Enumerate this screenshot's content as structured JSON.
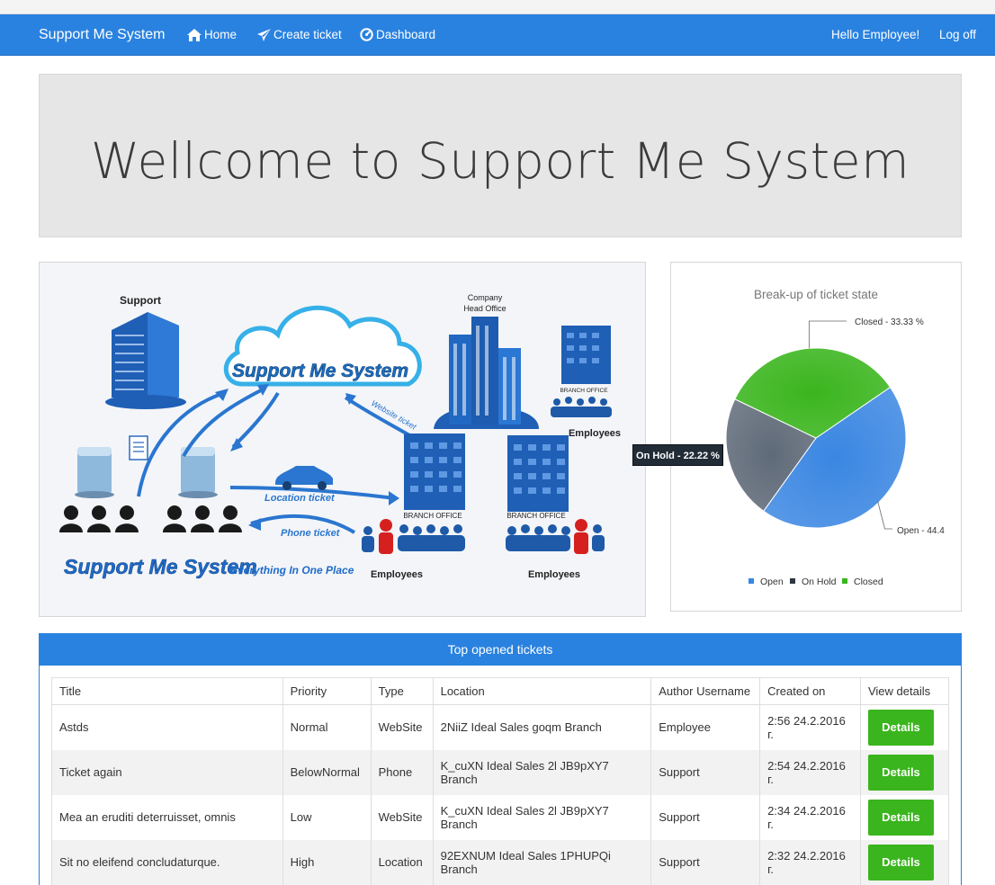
{
  "navbar": {
    "brand": "Support Me System",
    "links": [
      {
        "label": "Home",
        "icon": "home-icon"
      },
      {
        "label": "Create ticket",
        "icon": "paper-plane-icon"
      },
      {
        "label": "Dashboard",
        "icon": "dashboard-icon"
      }
    ],
    "greeting": "Hello Employee!",
    "logoff": "Log off",
    "color": "#2a82e0"
  },
  "jumbotron": {
    "heading": "Wellcome to Support Me System"
  },
  "illustration": {
    "labels": {
      "support": "Support",
      "head_office_1": "Company",
      "head_office_2": "Head Office",
      "cloud_text": "Support Me System",
      "website_ticket": "Website ticket",
      "location_ticket": "Location ticket",
      "phone_ticket": "Phone ticket",
      "branch_office": "BRANCH OFFICE",
      "employees": "Employees",
      "logo_main": "Support Me System",
      "logo_tagline": "Everything In One Place"
    }
  },
  "chart_data": {
    "type": "pie",
    "title": "Break-up of ticket state",
    "slices": [
      {
        "name": "Open",
        "value": 44.44,
        "label": "Open - 44.4",
        "color": "#3a86e2"
      },
      {
        "name": "On Hold",
        "value": 22.22,
        "label": "On Hold - 22.22 %",
        "color": "#5f6a78"
      },
      {
        "name": "Closed",
        "value": 33.33,
        "label": "Closed - 33.33 %",
        "color": "#3ab51d"
      }
    ],
    "legend": [
      "Open",
      "On Hold",
      "Closed"
    ],
    "legend_placement": "bottom",
    "tooltip": "On Hold - 22.22 %"
  },
  "tickets": {
    "title": "Top opened tickets",
    "columns": [
      "Title",
      "Priority",
      "Type",
      "Location",
      "Author Username",
      "Created on",
      "View details"
    ],
    "rows": [
      {
        "title": "Astds",
        "priority": "Normal",
        "type": "WebSite",
        "location": "2NiiZ Ideal Sales goqm Branch",
        "author": "Employee",
        "created": "2:56 24.2.2016 г.",
        "action": "Details"
      },
      {
        "title": "Ticket again",
        "priority": "BelowNormal",
        "type": "Phone",
        "location": "K_cuXN Ideal Sales 2l JB9pXY7 Branch",
        "author": "Support",
        "created": "2:54 24.2.2016 г.",
        "action": "Details"
      },
      {
        "title": "Mea an eruditi deterruisset, omnis",
        "priority": "Low",
        "type": "WebSite",
        "location": "K_cuXN Ideal Sales 2l JB9pXY7 Branch",
        "author": "Support",
        "created": "2:34 24.2.2016 г.",
        "action": "Details"
      },
      {
        "title": "Sit no eleifend concludaturque.",
        "priority": "High",
        "type": "Location",
        "location": "92EXNUM Ideal Sales 1PHUPQi Branch",
        "author": "Support",
        "created": "2:32 24.2.2016 г.",
        "action": "Details"
      }
    ],
    "button_color": "#3ab51d"
  }
}
